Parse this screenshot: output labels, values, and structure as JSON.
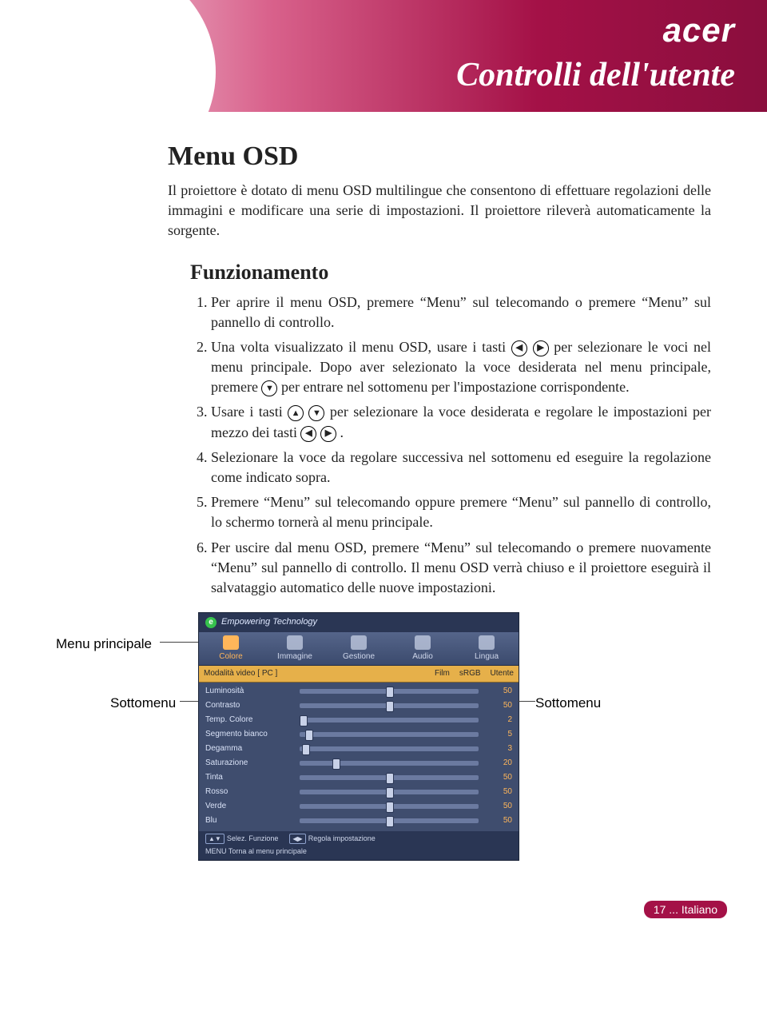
{
  "brand": "acer",
  "page_title": "Controlli dell'utente",
  "section_heading": "Menu OSD",
  "intro": "Il proiettore è dotato di menu OSD multilingue che consentono di effettuare regolazioni delle immagini e modificare una serie di impostazioni. Il proiettore rileverà automaticamente la sorgente.",
  "sub_heading": "Funzionamento",
  "steps": {
    "s1": "Per aprire il menu OSD, premere “Menu” sul telecomando o premere “Menu” sul pannello di controllo.",
    "s2a": "Una volta visualizzato il menu OSD, usare i tasti ",
    "s2b": " per selezionare le voci nel menu principale. Dopo aver selezionato la voce desiderata nel menu principale, premere ",
    "s2c": " per entrare nel sottomenu per l'impostazione corrispondente.",
    "s3a": "Usare i tasti ",
    "s3b": " per selezionare la voce desiderata e regolare le impostazioni per mezzo dei tasti ",
    "s3c": ".",
    "s4": "Selezionare la voce da regolare successiva nel sottomenu ed eseguire la regolazione come indicato sopra.",
    "s5": "Premere “Menu” sul telecomando oppure premere “Menu” sul pannello di controllo, lo schermo tornerà al menu principale.",
    "s6": "Per uscire dal menu OSD, premere “Menu” sul telecomando o premere nuovamente “Menu” sul pannello di controllo. Il menu OSD verrà chiuso e il proiettore eseguirà il salvataggio automatico delle nuove impostazioni."
  },
  "labels": {
    "main_menu": "Menu principale",
    "submenu": "Sottomenu"
  },
  "osd": {
    "et_title": "Empowering Technology",
    "tabs": [
      "Colore",
      "Immagine",
      "Gestione",
      "Audio",
      "Lingua"
    ],
    "mode_label": "Modalità video [ PC ]",
    "modes": [
      "Film",
      "sRGB",
      "Utente"
    ],
    "rows": [
      {
        "name": "Luminosità",
        "value": 50
      },
      {
        "name": "Contrasto",
        "value": 50
      },
      {
        "name": "Temp. Colore",
        "value": 2
      },
      {
        "name": "Segmento bianco",
        "value": 5
      },
      {
        "name": "Degamma",
        "value": 3
      },
      {
        "name": "Saturazione",
        "value": 20
      },
      {
        "name": "Tinta",
        "value": 50
      },
      {
        "name": "Rosso",
        "value": 50
      },
      {
        "name": "Verde",
        "value": 50
      },
      {
        "name": "Blu",
        "value": 50
      }
    ],
    "footer_select": "Selez. Funzione",
    "footer_adjust": "Regola impostazione",
    "footer_menu_key": "MENU",
    "footer_back": "Torna al menu principale"
  },
  "page_number": "17",
  "page_lang": "... Italiano"
}
